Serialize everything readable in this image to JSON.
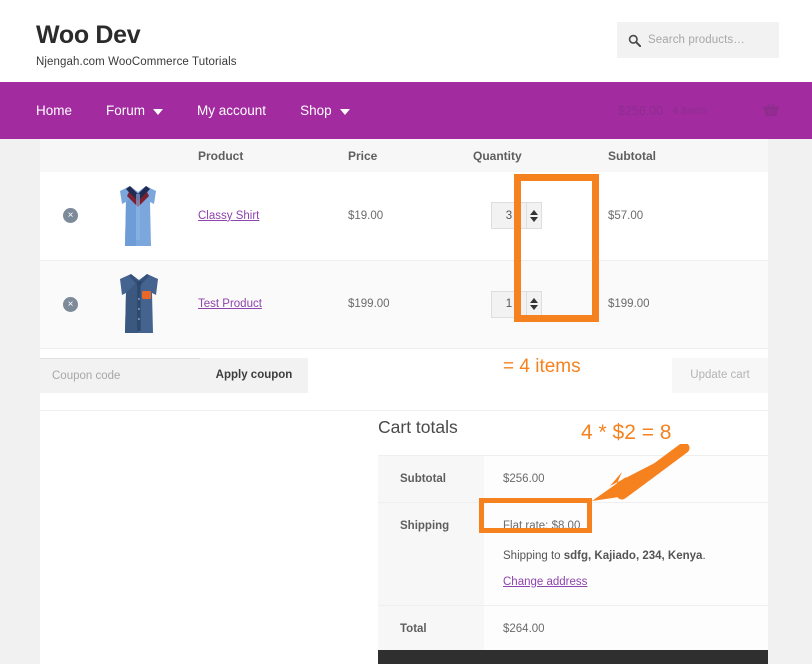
{
  "header": {
    "brand_title": "Woo Dev",
    "brand_tagline": "Njengah.com WooCommerce Tutorials",
    "search": {
      "icon": "search-icon",
      "placeholder": "Search products…"
    }
  },
  "nav": {
    "items": [
      {
        "label": "Home",
        "has_dropdown": false
      },
      {
        "label": "Forum",
        "has_dropdown": true
      },
      {
        "label": "My account",
        "has_dropdown": false
      },
      {
        "label": "Shop",
        "has_dropdown": true
      }
    ],
    "cart": {
      "amount": "$256.00",
      "count": "4 items",
      "icon": "shopping-basket-icon"
    },
    "background_color": "#a22ba0"
  },
  "cart_table": {
    "columns": [
      "",
      "",
      "Product",
      "Price",
      "Quantity",
      "Subtotal"
    ],
    "rows": [
      {
        "remove_label": "×",
        "thumbnail": "light-blue-shirt-image",
        "product": "Classy Shirt",
        "price": "$19.00",
        "quantity": "3",
        "subtotal": "$57.00"
      },
      {
        "remove_label": "×",
        "thumbnail": "denim-shirt-image",
        "product": "Test Product",
        "price": "$199.00",
        "quantity": "1",
        "subtotal": "$199.00"
      }
    ]
  },
  "coupon": {
    "placeholder": "Coupon code",
    "value": "",
    "apply_label": "Apply coupon",
    "update_label": "Update cart"
  },
  "cart_totals": {
    "heading": "Cart totals",
    "subtotal_label": "Subtotal",
    "subtotal_value": "$256.00",
    "shipping_label": "Shipping",
    "shipping_method": "Flat rate: $8.00",
    "shipping_to_prefix": "Shipping to ",
    "shipping_to_address": "sdfg, Kajiado, 234, Kenya",
    "shipping_to_suffix": ".",
    "change_address_label": "Change address",
    "total_label": "Total",
    "total_value": "$264.00"
  },
  "annotations": {
    "color": "#f5821f",
    "items_note": "= 4 items",
    "math_note": "4 * $2 = 8",
    "qty_highlight": "quantity-column-highlight",
    "flat_rate_highlight": "flat-rate-highlight",
    "arrow": "arrow-pointing-to-flat-rate"
  }
}
